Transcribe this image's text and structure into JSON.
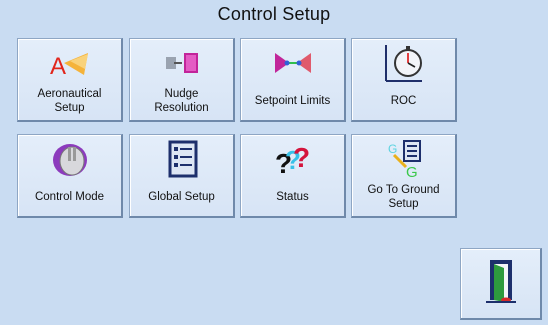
{
  "screen": {
    "title": "Control Setup"
  },
  "tiles": [
    {
      "label_lines": [
        "Aeronautical",
        "Setup"
      ],
      "icon": "aeronautical-icon"
    },
    {
      "label_lines": [
        "Nudge",
        "Resolution"
      ],
      "icon": "nudge-icon"
    },
    {
      "label_lines": [
        "Setpoint Limits"
      ],
      "icon": "setpoint-limits-icon"
    },
    {
      "label_lines": [
        "ROC"
      ],
      "icon": "roc-stopwatch-icon"
    },
    {
      "label_lines": [
        "Control Mode"
      ],
      "icon": "control-knob-icon"
    },
    {
      "label_lines": [
        "Global Setup"
      ],
      "icon": "checklist-icon"
    },
    {
      "label_lines": [
        "Status"
      ],
      "icon": "question-marks-icon"
    },
    {
      "label_lines": [
        "Go To Ground",
        "Setup"
      ],
      "icon": "ground-setup-icon"
    }
  ],
  "exit": {
    "icon": "exit-door-icon"
  },
  "colors": {
    "background": "#c9dcf2",
    "tile": "#dde8f7",
    "border": "#8ea6c4"
  }
}
